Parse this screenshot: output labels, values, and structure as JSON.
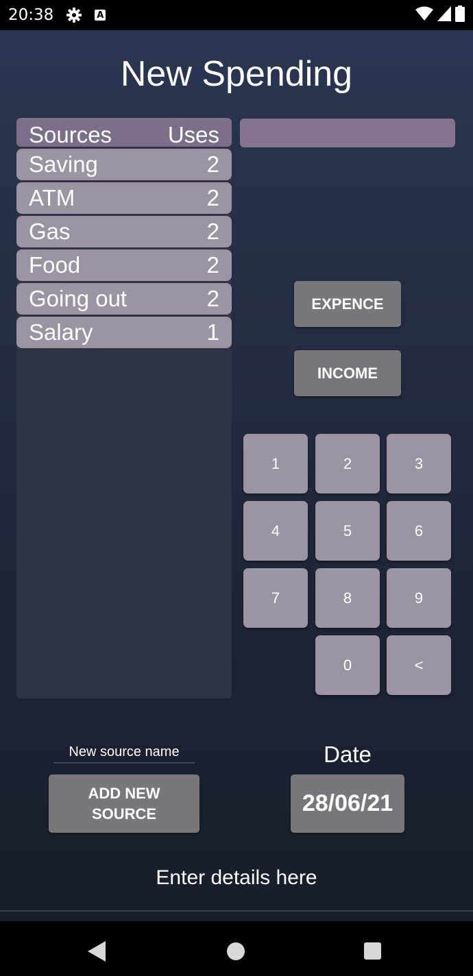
{
  "status": {
    "time": "20:38"
  },
  "title": "New Spending",
  "sources": {
    "header_left": "Sources",
    "header_right": "Uses",
    "items": [
      {
        "name": "Saving",
        "uses": "2"
      },
      {
        "name": "ATM",
        "uses": "2"
      },
      {
        "name": "Gas",
        "uses": "2"
      },
      {
        "name": "Food",
        "uses": "2"
      },
      {
        "name": "Going out",
        "uses": "2"
      },
      {
        "name": "Salary",
        "uses": "1"
      }
    ]
  },
  "amount": {
    "value": ""
  },
  "buttons": {
    "expence": "EXPENCE",
    "income": "INCOME",
    "add_source_line1": "ADD NEW",
    "add_source_line2": "SOURCE"
  },
  "keypad": {
    "k1": "1",
    "k2": "2",
    "k3": "3",
    "k4": "4",
    "k5": "5",
    "k6": "6",
    "k7": "7",
    "k8": "8",
    "k9": "9",
    "k0": "0",
    "backspace": "<"
  },
  "new_source": {
    "placeholder": "New source name"
  },
  "date": {
    "label": "Date",
    "value": "28/06/21"
  },
  "footer": {
    "text": "Enter details here"
  },
  "colors": {
    "header_row": "#7c6f8a",
    "list_row": "#9c94a3",
    "action_button": "#77777c",
    "amount_field": "#84738f"
  }
}
